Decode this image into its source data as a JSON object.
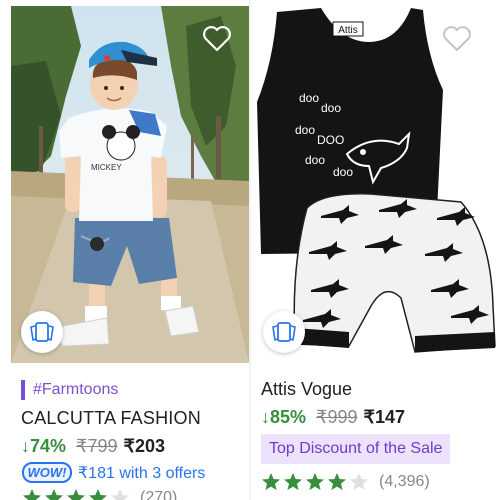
{
  "products": [
    {
      "sponsor_tag": "#Farmtoons",
      "brand": "CALCUTTA FASHION",
      "discount": "↓74%",
      "mrp": "₹799",
      "price": "₹203",
      "offer_badge": "WOW!",
      "offer_text": "₹181 with 3 offers",
      "rating_stars": 4,
      "rating_count": "(270)",
      "image_alt": "boy in white mickey t-shirt and denim shorts"
    },
    {
      "brand": "Attis Vogue",
      "discount": "↓85%",
      "mrp": "₹999",
      "price": "₹147",
      "highlight_tag": "Top Discount of the Sale",
      "rating_stars": 4,
      "rating_count": "(4,396)",
      "garment_label": "Attis",
      "garment_print": [
        "doo",
        "doo",
        "doo",
        "DOO",
        "doo",
        "doo"
      ]
    }
  ],
  "colors": {
    "green": "#388e3c",
    "blue": "#2874f0",
    "purple": "#7b4fd1",
    "star_filled": "#388e3c",
    "star_empty": "#e0e0e0"
  }
}
